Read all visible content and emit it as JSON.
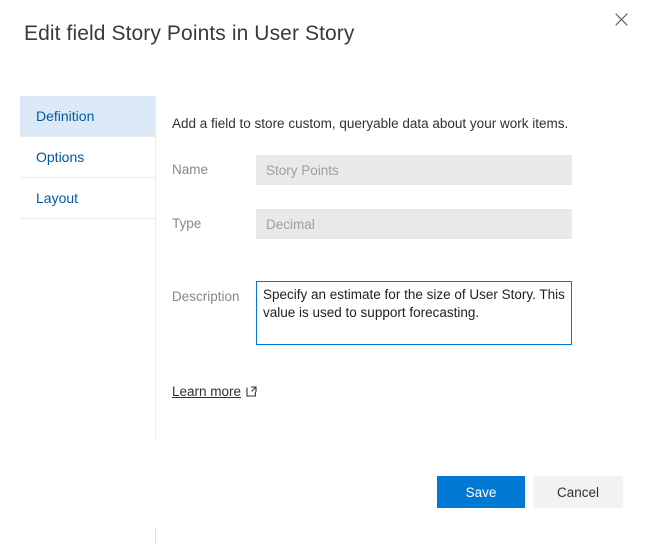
{
  "dialog": {
    "title": "Edit field Story Points in User Story",
    "close_icon": "close-icon",
    "close_label": "Close"
  },
  "rail": {
    "items": [
      {
        "label": "Definition",
        "selected": true
      },
      {
        "label": "Options",
        "selected": false
      },
      {
        "label": "Layout",
        "selected": false
      }
    ]
  },
  "content": {
    "intro": "Add a field to store custom, queryable data about your work items.",
    "fields": [
      {
        "label": "Name",
        "value": "Story Points",
        "placeholder": "Name",
        "disabled": true
      },
      {
        "label": "Type",
        "value": "Decimal",
        "placeholder": "Type",
        "disabled": true
      }
    ],
    "description": {
      "label": "Description",
      "value": "Specify an estimate for the size of User Story. This value is used to support forecasting.",
      "placeholder": "Description"
    },
    "learn_more": {
      "label": "Learn more",
      "icon": "external-link-icon"
    }
  },
  "footer": {
    "save_label": "Save",
    "cancel_label": "Cancel"
  },
  "colors": {
    "accent": "#0078d4",
    "accent_dark": "#005a9e",
    "selected_tab_bg": "#dceaf7",
    "disabled_field_bg": "#e9e9e9",
    "secondary_button_bg": "#f3f2f1"
  }
}
